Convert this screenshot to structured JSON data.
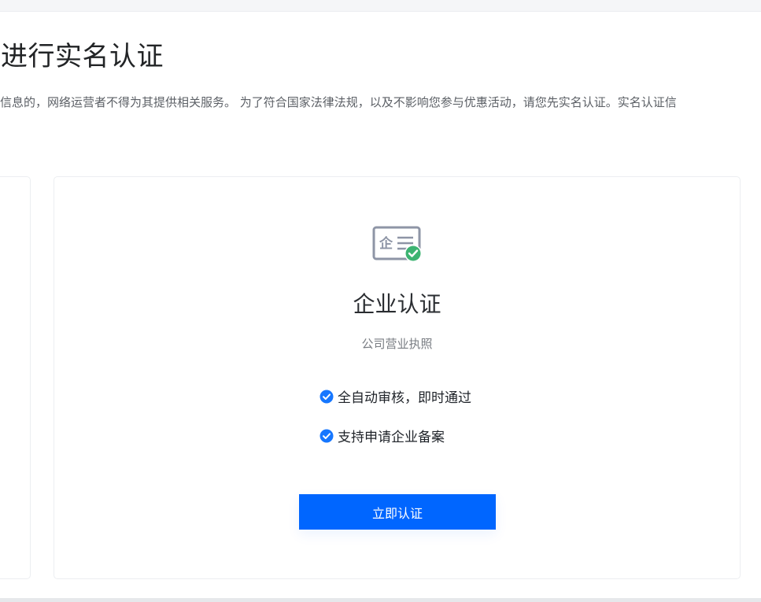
{
  "page": {
    "title": "进行实名认证",
    "notice": "信息的，网络运营者不得为其提供相关服务。 为了符合国家法律法规，以及不影响您参与优惠活动，请您先实名认证。实名认证信"
  },
  "enterprise_card": {
    "icon": "enterprise-license-icon",
    "title": "企业认证",
    "subtitle": "公司营业执照",
    "features": [
      "全自动审核，即时通过",
      "支持申请企业备案"
    ],
    "button_label": "立即认证"
  },
  "colors": {
    "accent": "#0066ff",
    "check": "#1677ff",
    "success_badge": "#3cb371",
    "icon_outline": "#8e95a6"
  }
}
